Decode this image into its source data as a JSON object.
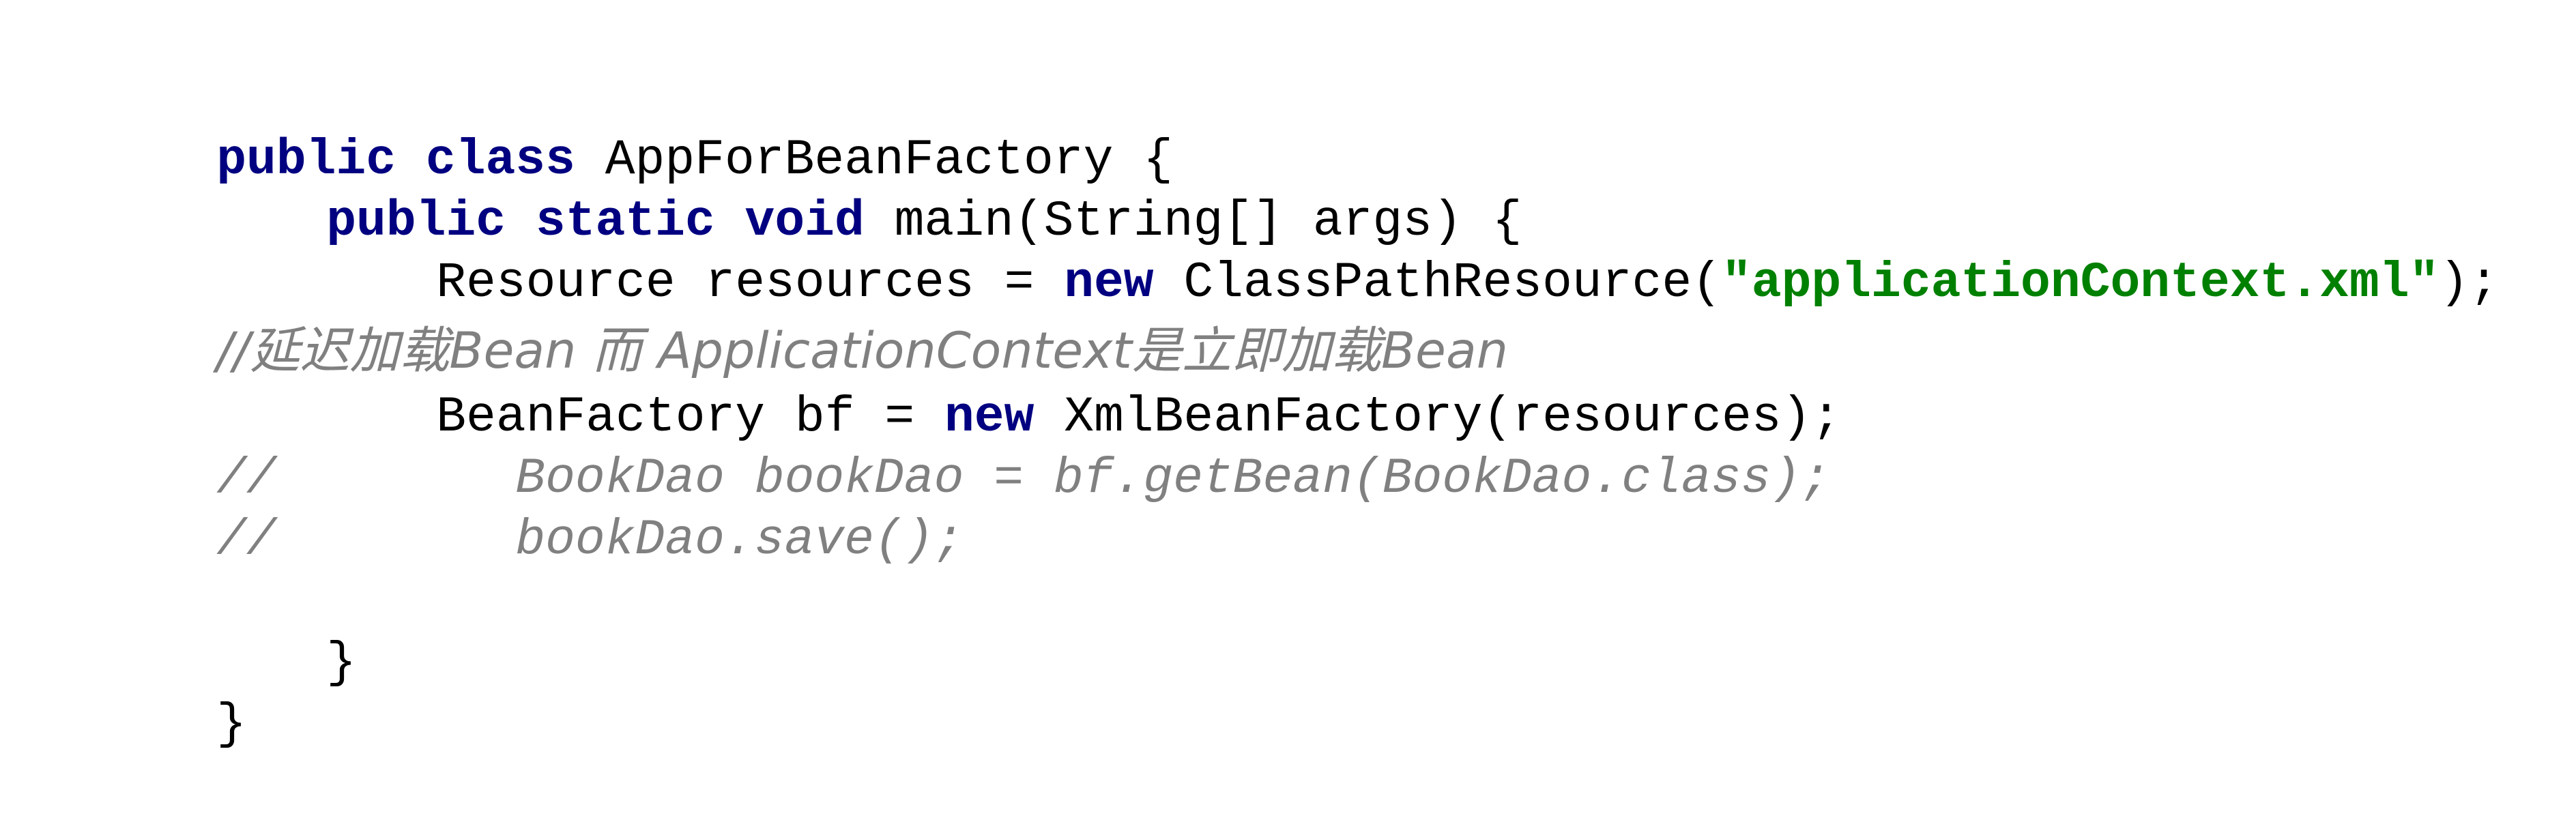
{
  "editor": {
    "colors": {
      "background": "#ffffff",
      "keyword": "#000080",
      "string": "#008000",
      "comment": "#808080",
      "text": "#000000"
    },
    "lines": [
      {
        "name": "class-declaration",
        "indent": 0,
        "tokens": [
          {
            "type": "kw",
            "text": "public"
          },
          {
            "type": "plain",
            "text": " "
          },
          {
            "type": "kw",
            "text": "class"
          },
          {
            "type": "plain",
            "text": " AppForBeanFactory {"
          }
        ]
      },
      {
        "name": "main-method-declaration",
        "indent": 1,
        "tokens": [
          {
            "type": "kw",
            "text": "public"
          },
          {
            "type": "plain",
            "text": " "
          },
          {
            "type": "kw",
            "text": "static"
          },
          {
            "type": "plain",
            "text": " "
          },
          {
            "type": "kw",
            "text": "void"
          },
          {
            "type": "plain",
            "text": " main(String[] args) {"
          }
        ]
      },
      {
        "name": "resource-declaration",
        "indent": 2,
        "tokens": [
          {
            "type": "plain",
            "text": "Resource resources = "
          },
          {
            "type": "kw",
            "text": "new"
          },
          {
            "type": "plain",
            "text": " ClassPathResource("
          },
          {
            "type": "str",
            "text": "\"applicationContext.xml\""
          },
          {
            "type": "plain",
            "text": ");"
          }
        ]
      },
      {
        "name": "comment-lazy-loading",
        "indent": 0,
        "tokens": [
          {
            "type": "cmt",
            "text": "//延迟加载Bean 而 ApplicationContext是立即加载Bean"
          }
        ]
      },
      {
        "name": "beanfactory-declaration",
        "indent": 2,
        "tokens": [
          {
            "type": "plain",
            "text": "BeanFactory bf = "
          },
          {
            "type": "kw",
            "text": "new"
          },
          {
            "type": "plain",
            "text": " XmlBeanFactory(resources);"
          }
        ]
      },
      {
        "name": "comment-get-bean",
        "indent": 0,
        "tokens": [
          {
            "type": "cmt",
            "text": "//        BookDao bookDao = bf.getBean(BookDao.class);"
          }
        ]
      },
      {
        "name": "comment-save",
        "indent": 0,
        "tokens": [
          {
            "type": "cmt",
            "text": "//        bookDao.save();"
          }
        ]
      },
      {
        "name": "blank-line",
        "indent": 0,
        "tokens": []
      },
      {
        "name": "method-close-brace",
        "indent": 1,
        "tokens": [
          {
            "type": "plain",
            "text": "}"
          }
        ]
      },
      {
        "name": "class-close-brace",
        "indent": 0,
        "tokens": [
          {
            "type": "plain",
            "text": "}"
          }
        ]
      }
    ]
  }
}
